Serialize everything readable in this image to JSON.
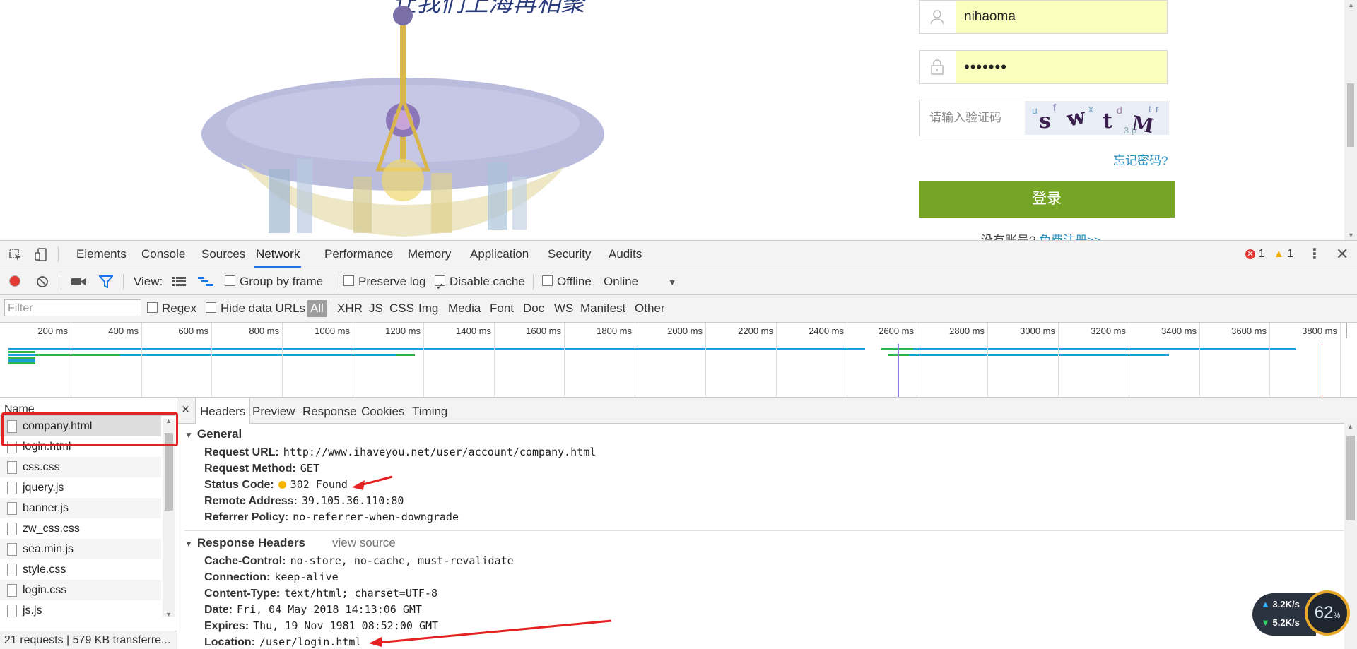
{
  "page": {
    "username": "nihaoma",
    "password_mask": "•••••••",
    "captcha_placeholder": "请输入验证码",
    "forgot_link": "忘记密码?",
    "login_button": "登录",
    "no_account": "没有账号?",
    "register_link": "免费注册>>",
    "title_glyphs": "让我们上海再相聚"
  },
  "devtools": {
    "tabs": [
      "Elements",
      "Console",
      "Sources",
      "Network",
      "Performance",
      "Memory",
      "Application",
      "Security",
      "Audits"
    ],
    "active_tab": "Network",
    "error_count": "1",
    "warning_count": "1",
    "toolbar": {
      "view_label": "View:",
      "group_by_frame": "Group by frame",
      "preserve_log": "Preserve log",
      "disable_cache": "Disable cache",
      "offline": "Offline",
      "throttle": "Online"
    },
    "filter": {
      "placeholder": "Filter",
      "regex": "Regex",
      "hide_data_urls": "Hide data URLs",
      "types": [
        "All",
        "XHR",
        "JS",
        "CSS",
        "Img",
        "Media",
        "Font",
        "Doc",
        "WS",
        "Manifest",
        "Other"
      ]
    },
    "timeline_ticks": [
      "200 ms",
      "400 ms",
      "600 ms",
      "800 ms",
      "1000 ms",
      "1200 ms",
      "1400 ms",
      "1600 ms",
      "1800 ms",
      "2000 ms",
      "2200 ms",
      "2400 ms",
      "2600 ms",
      "2800 ms",
      "3000 ms",
      "3200 ms",
      "3400 ms",
      "3600 ms",
      "3800 ms"
    ],
    "requests": {
      "header": "Name",
      "items": [
        "company.html",
        "login.html",
        "css.css",
        "jquery.js",
        "banner.js",
        "zw_css.css",
        "sea.min.js",
        "style.css",
        "login.css",
        "js.js"
      ],
      "selected": "company.html",
      "summary": "21 requests | 579 KB transferre..."
    },
    "detail": {
      "close": "×",
      "tabs": [
        "Headers",
        "Preview",
        "Response",
        "Cookies",
        "Timing"
      ],
      "active_tab": "Headers",
      "general_title": "General",
      "general": [
        {
          "key": "Request URL:",
          "value": "http://www.ihaveyou.net/user/account/company.html"
        },
        {
          "key": "Request Method:",
          "value": "GET"
        },
        {
          "key": "Status Code:",
          "value": "302 Found"
        },
        {
          "key": "Remote Address:",
          "value": "39.105.36.110:80"
        },
        {
          "key": "Referrer Policy:",
          "value": "no-referrer-when-downgrade"
        }
      ],
      "response_title": "Response Headers",
      "view_source": "view source",
      "response": [
        {
          "key": "Cache-Control:",
          "value": "no-store, no-cache, must-revalidate"
        },
        {
          "key": "Connection:",
          "value": "keep-alive"
        },
        {
          "key": "Content-Type:",
          "value": "text/html; charset=UTF-8"
        },
        {
          "key": "Date:",
          "value": "Fri, 04 May 2018 14:13:06 GMT"
        },
        {
          "key": "Expires:",
          "value": "Thu, 19 Nov 1981 08:52:00 GMT"
        },
        {
          "key": "Location:",
          "value": "/user/login.html"
        }
      ]
    }
  },
  "speed_widget": {
    "upload": "3.2K/s",
    "download": "5.2K/s",
    "percent": "62",
    "percent_unit": "%"
  },
  "colors": {
    "accent_blue": "#1a73e8",
    "login_green": "#76a526",
    "autofill_yellow": "#faffbd",
    "annotation_red": "#e52222",
    "status_dot": "#f5b400"
  }
}
